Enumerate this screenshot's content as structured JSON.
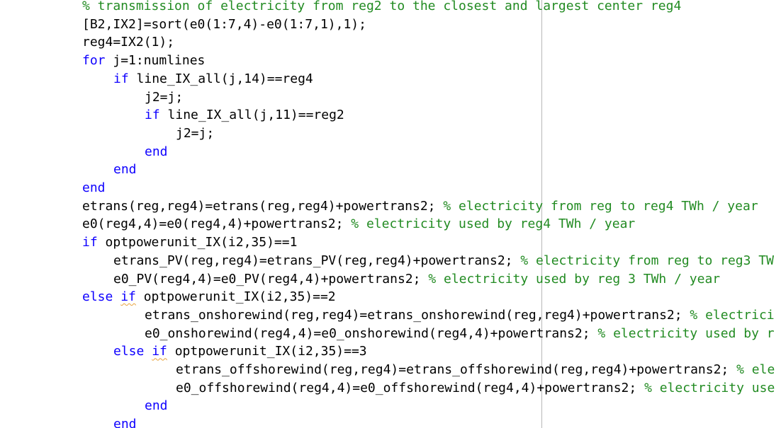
{
  "editor": {
    "colors": {
      "keyword": "#0E00FF",
      "comment": "#228B22",
      "text": "#000000",
      "warning_underline": "#E8A33D",
      "right_margin_line": "#B7B7B7"
    },
    "lines": [
      {
        "indent": 0,
        "segments": [
          {
            "type": "comment",
            "text": "% transmission of electricity from reg2 to the closest and largest center reg4"
          }
        ]
      },
      {
        "indent": 0,
        "segments": [
          {
            "type": "text",
            "text": "[B2,IX2]=sort(e0(1:7,4)-e0(1:7,1),1);"
          }
        ]
      },
      {
        "indent": 0,
        "segments": [
          {
            "type": "text",
            "text": "reg4=IX2(1);"
          }
        ]
      },
      {
        "indent": 0,
        "segments": [
          {
            "type": "keyword",
            "text": "for"
          },
          {
            "type": "text",
            "text": " j=1:numlines"
          }
        ]
      },
      {
        "indent": 1,
        "segments": [
          {
            "type": "keyword",
            "text": "if"
          },
          {
            "type": "text",
            "text": " line_IX_all(j,14)==reg4"
          }
        ]
      },
      {
        "indent": 2,
        "segments": [
          {
            "type": "text",
            "text": "j2=j;"
          }
        ]
      },
      {
        "indent": 2,
        "segments": [
          {
            "type": "keyword",
            "text": "if"
          },
          {
            "type": "text",
            "text": " line_IX_all(j,11)==reg2"
          }
        ]
      },
      {
        "indent": 3,
        "segments": [
          {
            "type": "text",
            "text": "j2=j;"
          }
        ]
      },
      {
        "indent": 2,
        "segments": [
          {
            "type": "keyword",
            "text": "end"
          }
        ]
      },
      {
        "indent": 1,
        "segments": [
          {
            "type": "keyword",
            "text": "end"
          }
        ]
      },
      {
        "indent": 0,
        "segments": [
          {
            "type": "keyword",
            "text": "end"
          }
        ]
      },
      {
        "indent": 0,
        "segments": [
          {
            "type": "text",
            "text": "etrans(reg,reg4)=etrans(reg,reg4)+powertrans2; "
          },
          {
            "type": "comment",
            "text": "% electricity from reg to reg4 TWh / year"
          }
        ]
      },
      {
        "indent": 0,
        "segments": [
          {
            "type": "text",
            "text": "e0(reg4,4)=e0(reg4,4)+powertrans2; "
          },
          {
            "type": "comment",
            "text": "% electricity used by reg4 TWh / year"
          }
        ]
      },
      {
        "indent": 0,
        "segments": [
          {
            "type": "keyword",
            "text": "if"
          },
          {
            "type": "text",
            "text": " optpowerunit_IX(i2,35)==1"
          }
        ]
      },
      {
        "indent": 1,
        "segments": [
          {
            "type": "text",
            "text": "etrans_PV(reg,reg4)=etrans_PV(reg,reg4)+powertrans2; "
          },
          {
            "type": "comment",
            "text": "% electricity from reg to reg3 TW"
          }
        ]
      },
      {
        "indent": 1,
        "segments": [
          {
            "type": "text",
            "text": "e0_PV(reg4,4)=e0_PV(reg4,4)+powertrans2; "
          },
          {
            "type": "comment",
            "text": "% electricity used by reg 3 TWh / year"
          }
        ]
      },
      {
        "indent": 0,
        "segments": [
          {
            "type": "keyword",
            "text": "else "
          },
          {
            "type": "keyword_warn",
            "text": "if"
          },
          {
            "type": "text",
            "text": " optpowerunit_IX(i2,35)==2"
          }
        ]
      },
      {
        "indent": 2,
        "segments": [
          {
            "type": "text",
            "text": "etrans_onshorewind(reg,reg4)=etrans_onshorewind(reg,reg4)+powertrans2; "
          },
          {
            "type": "comment",
            "text": "% electrici"
          }
        ]
      },
      {
        "indent": 2,
        "segments": [
          {
            "type": "text",
            "text": "e0_onshorewind(reg4,4)=e0_onshorewind(reg4,4)+powertrans2; "
          },
          {
            "type": "comment",
            "text": "% electricity used by r"
          }
        ]
      },
      {
        "indent": 1,
        "segments": [
          {
            "type": "keyword",
            "text": "else "
          },
          {
            "type": "keyword_warn",
            "text": "if"
          },
          {
            "type": "text",
            "text": " optpowerunit_IX(i2,35)==3"
          }
        ]
      },
      {
        "indent": 3,
        "segments": [
          {
            "type": "text",
            "text": "etrans_offshorewind(reg,reg4)=etrans_offshorewind(reg,reg4)+powertrans2; "
          },
          {
            "type": "comment",
            "text": "% ele"
          }
        ]
      },
      {
        "indent": 3,
        "segments": [
          {
            "type": "text",
            "text": "e0_offshorewind(reg4,4)=e0_offshorewind(reg4,4)+powertrans2; "
          },
          {
            "type": "comment",
            "text": "% electricity use"
          }
        ]
      },
      {
        "indent": 2,
        "segments": [
          {
            "type": "keyword",
            "text": "end"
          }
        ]
      },
      {
        "indent": 1,
        "segments": [
          {
            "type": "keyword",
            "text": "end"
          }
        ]
      }
    ]
  }
}
